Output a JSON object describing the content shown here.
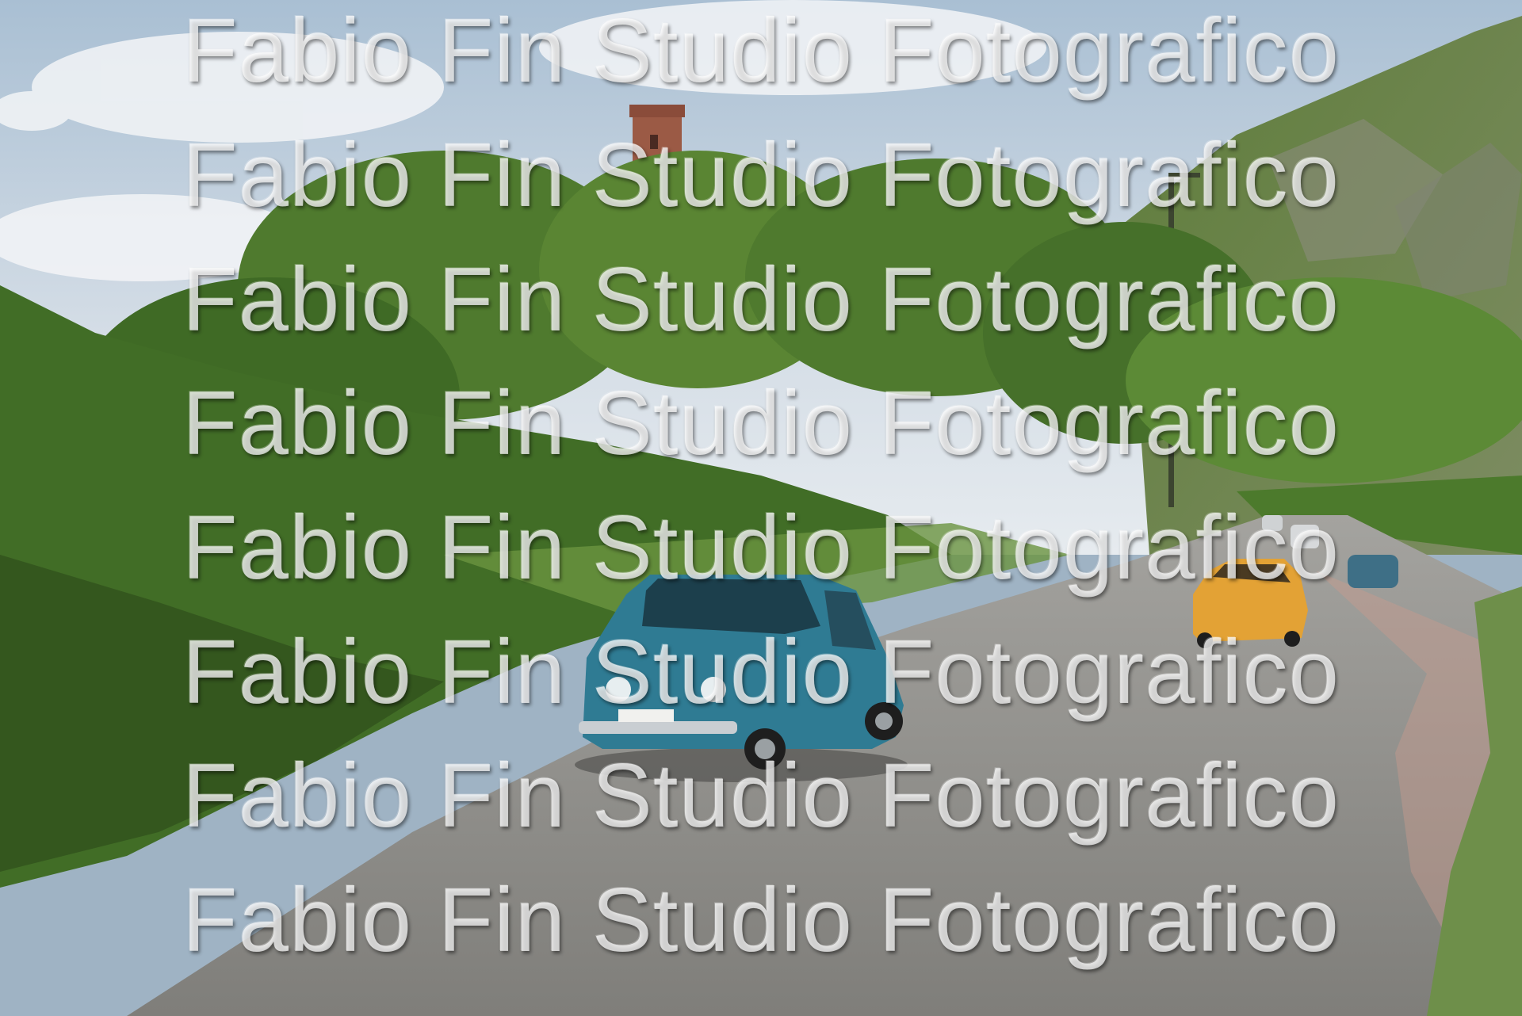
{
  "photo": {
    "subject": "vintage-cars-on-country-road",
    "colors": {
      "sky": "#c9d6e2",
      "foliage": "#4f7a2e",
      "foliage_dark": "#2f4f1b",
      "road": "#8d8c88",
      "blue_car": "#2f7b93",
      "yellow_car": "#e3a235",
      "tower": "#9b5a45"
    }
  },
  "watermark": {
    "lines": [
      "Fabio Fin Studio Fotografico",
      "Fabio Fin Studio Fotografico",
      "Fabio Fin Studio Fotografico",
      "Fabio Fin Studio Fotografico",
      "Fabio Fin Studio Fotografico",
      "Fabio Fin Studio Fotografico",
      "Fabio Fin Studio Fotografico",
      "Fabio Fin Studio Fotografico"
    ]
  }
}
